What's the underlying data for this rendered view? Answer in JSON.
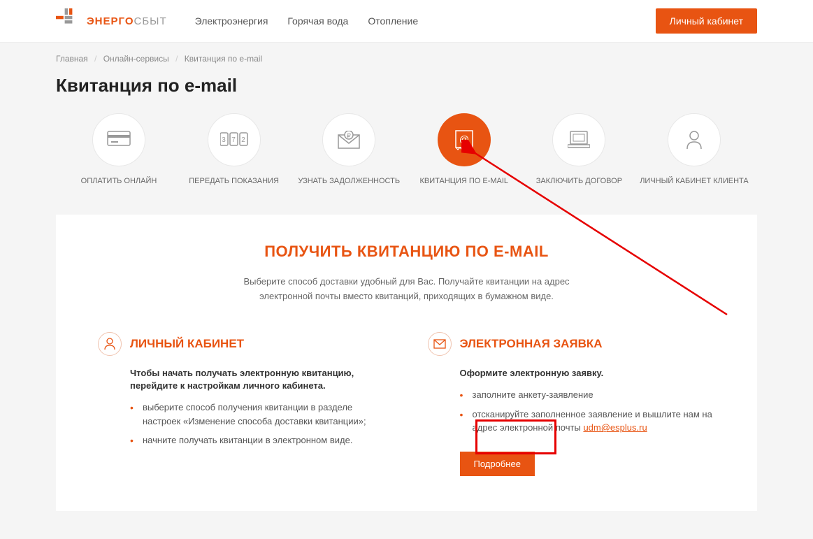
{
  "header": {
    "logo_prefix": "ЭНЕРГО",
    "logo_suffix": "СБЫТ",
    "nav": [
      "Электроэнергия",
      "Горячая вода",
      "Отопление"
    ],
    "login_btn": "Личный кабинет"
  },
  "breadcrumb": {
    "items": [
      "Главная",
      "Онлайн-сервисы",
      "Квитанция по e-mail"
    ]
  },
  "page_title": "Квитанция по e-mail",
  "services": [
    {
      "label": "ОПЛАТИТЬ ОНЛАЙН",
      "active": false
    },
    {
      "label": "ПЕРЕДАТЬ ПОКАЗАНИЯ",
      "active": false
    },
    {
      "label": "УЗНАТЬ ЗАДОЛЖЕННОСТЬ",
      "active": false
    },
    {
      "label": "КВИТАНЦИЯ ПО E-MAIL",
      "active": true
    },
    {
      "label": "ЗАКЛЮЧИТЬ ДОГОВОР",
      "active": false
    },
    {
      "label": "ЛИЧНЫЙ КАБИНЕТ КЛИЕНТА",
      "active": false
    }
  ],
  "panel": {
    "title": "ПОЛУЧИТЬ КВИТАНЦИЮ ПО E-MAIL",
    "subtitle": "Выберите способ доставки удобный для Вас. Получайте квитанции на адрес электронной почты вместо квитанций, приходящих в бумажном виде.",
    "left": {
      "title": "ЛИЧНЫЙ КАБИНЕТ",
      "intro": "Чтобы начать получать электронную квитанцию, перейдите к настройкам личного кабинета.",
      "items": [
        "выберите способ получения квитанции в разделе настроек «Изменение способа доставки квитанции»;",
        "начните получать квитанции в электронном виде."
      ]
    },
    "right": {
      "title": "ЭЛЕКТРОННАЯ ЗАЯВКА",
      "intro": "Оформите электронную заявку.",
      "items": [
        "заполните анкету-заявление",
        "отсканируйте заполненное заявление и вышлите нам на адрес электронной почты "
      ],
      "email": "udm@esplus.ru",
      "more_btn": "Подробнее"
    }
  }
}
